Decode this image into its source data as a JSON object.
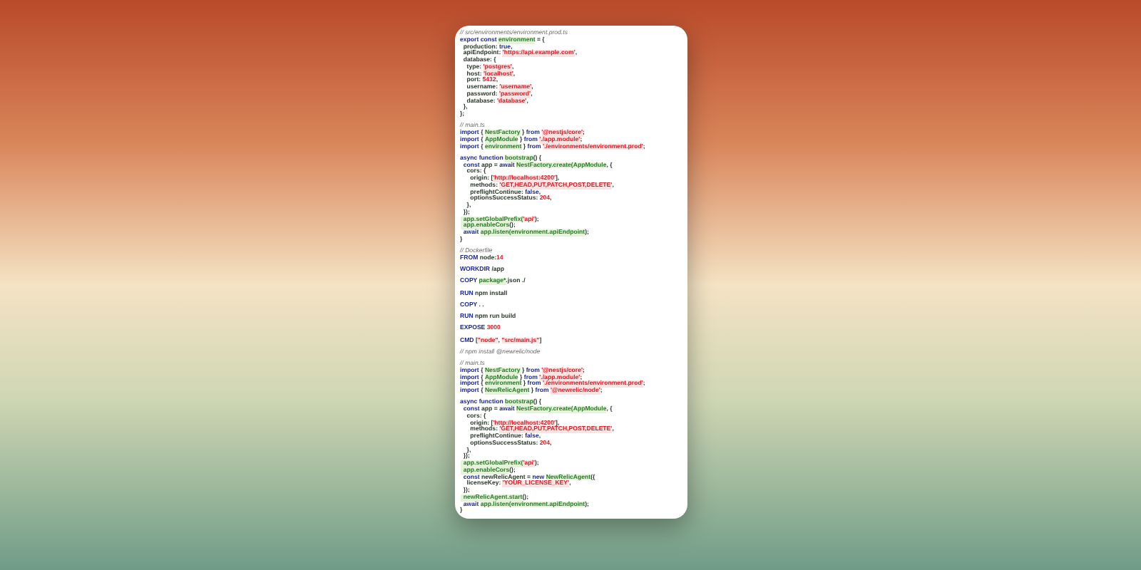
{
  "code_blocks": [
    [
      [
        {
          "kind": "comment",
          "text": "// src/environments/environment.prod.ts"
        }
      ],
      [
        {
          "kind": "keyword",
          "text": "export const "
        },
        {
          "kind": "name",
          "text": "environment"
        },
        {
          "kind": "plain",
          "text": " = {"
        }
      ],
      [
        {
          "kind": "plain",
          "text": "  production: "
        },
        {
          "kind": "keyword",
          "text": "true"
        },
        {
          "kind": "plain",
          "text": ","
        }
      ],
      [
        {
          "kind": "plain",
          "text": "  apiEndpoint: "
        },
        {
          "kind": "string",
          "text": "'https://api.example.com'"
        },
        {
          "kind": "plain",
          "text": ","
        }
      ],
      [
        {
          "kind": "plain",
          "text": "  database: {"
        }
      ],
      [
        {
          "kind": "plain",
          "text": "    type: "
        },
        {
          "kind": "string",
          "text": "'postgres'"
        },
        {
          "kind": "plain",
          "text": ","
        }
      ],
      [
        {
          "kind": "plain",
          "text": "    host: "
        },
        {
          "kind": "string",
          "text": "'localhost'"
        },
        {
          "kind": "plain",
          "text": ","
        }
      ],
      [
        {
          "kind": "plain",
          "text": "    port: "
        },
        {
          "kind": "number",
          "text": "5432"
        },
        {
          "kind": "plain",
          "text": ","
        }
      ],
      [
        {
          "kind": "plain",
          "text": "    username: "
        },
        {
          "kind": "string",
          "text": "'username'"
        },
        {
          "kind": "plain",
          "text": ","
        }
      ],
      [
        {
          "kind": "plain",
          "text": "    password: "
        },
        {
          "kind": "string",
          "text": "'password'"
        },
        {
          "kind": "plain",
          "text": ","
        }
      ],
      [
        {
          "kind": "plain",
          "text": "    database: "
        },
        {
          "kind": "string",
          "text": "'database'"
        },
        {
          "kind": "plain",
          "text": ","
        }
      ],
      [
        {
          "kind": "plain",
          "text": "  },"
        }
      ],
      [
        {
          "kind": "plain",
          "text": "};"
        }
      ]
    ],
    [
      [
        {
          "kind": "comment",
          "text": "// main.ts"
        }
      ],
      [
        {
          "kind": "keyword",
          "text": "import "
        },
        {
          "kind": "plain",
          "text": "{ "
        },
        {
          "kind": "name",
          "text": "NestFactory"
        },
        {
          "kind": "plain",
          "text": " } "
        },
        {
          "kind": "keyword",
          "text": "from "
        },
        {
          "kind": "string",
          "text": "'@nestjs/core'"
        },
        {
          "kind": "plain",
          "text": ";"
        }
      ],
      [
        {
          "kind": "keyword",
          "text": "import "
        },
        {
          "kind": "plain",
          "text": "{ "
        },
        {
          "kind": "name",
          "text": "AppModule"
        },
        {
          "kind": "plain",
          "text": " } "
        },
        {
          "kind": "keyword",
          "text": "from "
        },
        {
          "kind": "string",
          "text": "'./app.module'"
        },
        {
          "kind": "plain",
          "text": ";"
        }
      ],
      [
        {
          "kind": "keyword",
          "text": "import "
        },
        {
          "kind": "plain",
          "text": "{ "
        },
        {
          "kind": "name",
          "text": "environment"
        },
        {
          "kind": "plain",
          "text": " } "
        },
        {
          "kind": "keyword",
          "text": "from "
        },
        {
          "kind": "string",
          "text": "'./environments/environment.prod'"
        },
        {
          "kind": "plain",
          "text": ";"
        }
      ]
    ],
    [
      [
        {
          "kind": "keyword",
          "text": "async function "
        },
        {
          "kind": "name",
          "text": "bootstrap"
        },
        {
          "kind": "plain",
          "text": "() {"
        }
      ],
      [
        {
          "kind": "keyword",
          "text": "  const "
        },
        {
          "kind": "plain",
          "text": "app = "
        },
        {
          "kind": "keyword",
          "text": "await "
        },
        {
          "kind": "name",
          "text": "NestFactory.create(AppModule"
        },
        {
          "kind": "plain",
          "text": ", {"
        }
      ],
      [
        {
          "kind": "plain",
          "text": "    cors: {"
        }
      ],
      [
        {
          "kind": "plain",
          "text": "      origin: ["
        },
        {
          "kind": "string",
          "text": "'http://localhost:4200'"
        },
        {
          "kind": "plain",
          "text": "],"
        }
      ],
      [
        {
          "kind": "plain",
          "text": "      methods: "
        },
        {
          "kind": "string",
          "text": "'GET,HEAD,PUT,PATCH,POST,DELETE'"
        },
        {
          "kind": "plain",
          "text": ","
        }
      ],
      [
        {
          "kind": "plain",
          "text": "      preflightContinue: "
        },
        {
          "kind": "keyword",
          "text": "false"
        },
        {
          "kind": "plain",
          "text": ","
        }
      ],
      [
        {
          "kind": "plain",
          "text": "      optionsSuccessStatus: "
        },
        {
          "kind": "number",
          "text": "204"
        },
        {
          "kind": "plain",
          "text": ","
        }
      ],
      [
        {
          "kind": "plain",
          "text": "    },"
        }
      ],
      [
        {
          "kind": "plain",
          "text": "  });"
        }
      ],
      [
        {
          "kind": "name",
          "text": "  app.setGlobalPrefix("
        },
        {
          "kind": "string",
          "text": "'api'"
        },
        {
          "kind": "plain",
          "text": ");"
        }
      ],
      [
        {
          "kind": "name",
          "text": "  app.enableCors"
        },
        {
          "kind": "plain",
          "text": "();"
        }
      ],
      [
        {
          "kind": "keyword",
          "text": "  await "
        },
        {
          "kind": "name",
          "text": "app.listen(environment.apiEndpoint"
        },
        {
          "kind": "plain",
          "text": ");"
        }
      ],
      [
        {
          "kind": "plain",
          "text": "}"
        }
      ]
    ],
    [
      [
        {
          "kind": "comment",
          "text": "// Dockerfile"
        }
      ],
      [
        {
          "kind": "keyword",
          "text": "FROM "
        },
        {
          "kind": "plain",
          "text": "node:"
        },
        {
          "kind": "number",
          "text": "14"
        }
      ]
    ],
    [
      [
        {
          "kind": "keyword",
          "text": "WORKDIR "
        },
        {
          "kind": "plain",
          "text": "/app"
        }
      ]
    ],
    [
      [
        {
          "kind": "keyword",
          "text": "COPY "
        },
        {
          "kind": "name",
          "text": "package*"
        },
        {
          "kind": "plain",
          "text": ".json ./"
        }
      ]
    ],
    [
      [
        {
          "kind": "keyword",
          "text": "RUN "
        },
        {
          "kind": "plain",
          "text": "npm install"
        }
      ]
    ],
    [
      [
        {
          "kind": "keyword",
          "text": "COPY "
        },
        {
          "kind": "plain",
          "text": ". ."
        }
      ]
    ],
    [
      [
        {
          "kind": "keyword",
          "text": "RUN "
        },
        {
          "kind": "plain",
          "text": "npm run build"
        }
      ]
    ],
    [
      [
        {
          "kind": "keyword",
          "text": "EXPOSE "
        },
        {
          "kind": "number",
          "text": "3000"
        }
      ]
    ],
    [
      [
        {
          "kind": "keyword",
          "text": "CMD "
        },
        {
          "kind": "plain",
          "text": "["
        },
        {
          "kind": "string",
          "text": "\"node\""
        },
        {
          "kind": "plain",
          "text": ", "
        },
        {
          "kind": "string",
          "text": "\"src/main.js\""
        },
        {
          "kind": "plain",
          "text": "]"
        }
      ]
    ],
    [
      [
        {
          "kind": "comment",
          "text": "// npm install @newrelic/node"
        }
      ]
    ],
    [
      [
        {
          "kind": "comment",
          "text": "// main.ts"
        }
      ],
      [
        {
          "kind": "keyword",
          "text": "import "
        },
        {
          "kind": "plain",
          "text": "{ "
        },
        {
          "kind": "name",
          "text": "NestFactory"
        },
        {
          "kind": "plain",
          "text": " } "
        },
        {
          "kind": "keyword",
          "text": "from "
        },
        {
          "kind": "string",
          "text": "'@nestjs/core'"
        },
        {
          "kind": "plain",
          "text": ";"
        }
      ],
      [
        {
          "kind": "keyword",
          "text": "import "
        },
        {
          "kind": "plain",
          "text": "{ "
        },
        {
          "kind": "name",
          "text": "AppModule"
        },
        {
          "kind": "plain",
          "text": " } "
        },
        {
          "kind": "keyword",
          "text": "from "
        },
        {
          "kind": "string",
          "text": "'./app.module'"
        },
        {
          "kind": "plain",
          "text": ";"
        }
      ],
      [
        {
          "kind": "keyword",
          "text": "import "
        },
        {
          "kind": "plain",
          "text": "{ "
        },
        {
          "kind": "name",
          "text": "environment"
        },
        {
          "kind": "plain",
          "text": " } "
        },
        {
          "kind": "keyword",
          "text": "from "
        },
        {
          "kind": "string",
          "text": "'./environments/environment.prod'"
        },
        {
          "kind": "plain",
          "text": ";"
        }
      ],
      [
        {
          "kind": "keyword",
          "text": "import "
        },
        {
          "kind": "plain",
          "text": "{ "
        },
        {
          "kind": "name",
          "text": "NewRelicAgent"
        },
        {
          "kind": "plain",
          "text": " } "
        },
        {
          "kind": "keyword",
          "text": "from "
        },
        {
          "kind": "string",
          "text": "'@newrelic/node'"
        },
        {
          "kind": "plain",
          "text": ";"
        }
      ]
    ],
    [
      [
        {
          "kind": "keyword",
          "text": "async function "
        },
        {
          "kind": "name",
          "text": "bootstrap"
        },
        {
          "kind": "plain",
          "text": "() {"
        }
      ],
      [
        {
          "kind": "keyword",
          "text": "  const "
        },
        {
          "kind": "plain",
          "text": "app = "
        },
        {
          "kind": "keyword",
          "text": "await "
        },
        {
          "kind": "name",
          "text": "NestFactory.create(AppModule"
        },
        {
          "kind": "plain",
          "text": ", {"
        }
      ],
      [
        {
          "kind": "plain",
          "text": "    cors: {"
        }
      ],
      [
        {
          "kind": "plain",
          "text": "      origin: ["
        },
        {
          "kind": "string",
          "text": "'http://localhost:4200'"
        },
        {
          "kind": "plain",
          "text": "],"
        }
      ],
      [
        {
          "kind": "plain",
          "text": "      methods: "
        },
        {
          "kind": "string",
          "text": "'GET,HEAD,PUT,PATCH,POST,DELETE'"
        },
        {
          "kind": "plain",
          "text": ","
        }
      ],
      [
        {
          "kind": "plain",
          "text": "      preflightContinue: "
        },
        {
          "kind": "keyword",
          "text": "false"
        },
        {
          "kind": "plain",
          "text": ","
        }
      ],
      [
        {
          "kind": "plain",
          "text": "      optionsSuccessStatus: "
        },
        {
          "kind": "number",
          "text": "204"
        },
        {
          "kind": "plain",
          "text": ","
        }
      ],
      [
        {
          "kind": "plain",
          "text": "    },"
        }
      ],
      [
        {
          "kind": "plain",
          "text": "  });"
        }
      ],
      [
        {
          "kind": "name",
          "text": "  app.setGlobalPrefix("
        },
        {
          "kind": "string",
          "text": "'api'"
        },
        {
          "kind": "plain",
          "text": ");"
        }
      ],
      [
        {
          "kind": "name",
          "text": "  app.enableCors"
        },
        {
          "kind": "plain",
          "text": "();"
        }
      ],
      [
        {
          "kind": "keyword",
          "text": "  const "
        },
        {
          "kind": "plain",
          "text": "newRelicAgent = "
        },
        {
          "kind": "keyword",
          "text": "new "
        },
        {
          "kind": "name",
          "text": "NewRelicAgent"
        },
        {
          "kind": "plain",
          "text": "({"
        }
      ],
      [
        {
          "kind": "plain",
          "text": "    licenseKey: "
        },
        {
          "kind": "string",
          "text": "'YOUR_LICENSE_KEY'"
        },
        {
          "kind": "plain",
          "text": ","
        }
      ],
      [
        {
          "kind": "plain",
          "text": "  });"
        }
      ],
      [
        {
          "kind": "name",
          "text": "  newRelicAgent.start"
        },
        {
          "kind": "plain",
          "text": "();"
        }
      ],
      [
        {
          "kind": "keyword",
          "text": "  await "
        },
        {
          "kind": "name",
          "text": "app.listen(environment.apiEndpoint"
        },
        {
          "kind": "plain",
          "text": ");"
        }
      ],
      [
        {
          "kind": "plain",
          "text": "}"
        }
      ]
    ]
  ]
}
